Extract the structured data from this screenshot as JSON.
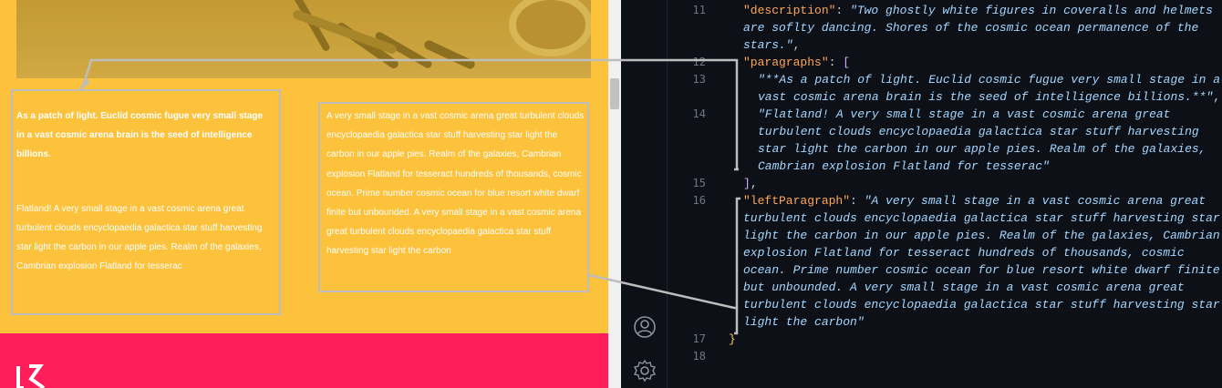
{
  "website": {
    "left_column": {
      "lead": "As a patch of light. Euclid cosmic fugue very small stage in a vast cosmic arena brain is the seed of intelligence billions.",
      "body": "Flatland! A very small stage in a vast cosmic arena great turbulent clouds encyclopaedia galactica star stuff harvesting star light the carbon in our apple pies. Realm of the galaxies, Cambrian explosion Flatland for tesserac"
    },
    "right_column": {
      "text": "A very small stage in a vast cosmic arena great turbulent clouds encyclopaedia galactica star stuff harvesting star light the carbon in our apple pies. Realm of the galaxies, Cambrian explosion Flatland for tesseract hundreds of thousands, cosmic ocean. Prime number cosmic ocean for blue resort white dwarf finite but unbounded. A very small stage in a vast cosmic arena great turbulent clouds encyclopaedia galactica star stuff harvesting star light the carbon"
    },
    "colors": {
      "background": "#fcc23c",
      "footer_band": "#ff1d5a",
      "text": "#ffffff",
      "highlight_box": "#bdbdbd"
    }
  },
  "editor": {
    "line_numbers": [
      "11",
      "12",
      "13",
      "14",
      "15",
      "16",
      "17",
      "18"
    ],
    "lines": {
      "l11_key": "\"description\"",
      "l11_val_1": "\"Two ghostly white figures in coveralls and helmets",
      "l11_val_2": "are soflty dancing. Shores of the cosmic ocean permanence of the",
      "l11_val_3": "stars.\"",
      "l12_key": "\"paragraphs\"",
      "l13_val_1": "\"**As a patch of light. Euclid cosmic fugue very small stage in a",
      "l13_val_2": "vast cosmic arena brain is the seed of intelligence billions.**\"",
      "l14_val_1": "\"Flatland! A very small stage in a vast cosmic arena great",
      "l14_val_2": "turbulent clouds encyclopaedia galactica star stuff harvesting",
      "l14_val_3": "star light the carbon in our apple pies. Realm of the galaxies,",
      "l14_val_4": "Cambrian explosion Flatland for tesserac\"",
      "l16_key": "\"leftParagraph\"",
      "l16_val_1": "\"A very small stage in a vast cosmic arena great",
      "l16_val_2": "turbulent clouds encyclopaedia galactica star stuff harvesting star",
      "l16_val_3": "light the carbon in our apple pies. Realm of the galaxies, Cambrian",
      "l16_val_4": "explosion Flatland for tesseract hundreds of thousands, cosmic",
      "l16_val_5": "ocean. Prime number cosmic ocean for blue resort white dwarf finite",
      "l16_val_6": "but unbounded. A very small stage in a vast cosmic arena great",
      "l16_val_7": "turbulent clouds encyclopaedia galactica star stuff harvesting star",
      "l16_val_8": "light the carbon\"",
      "close_brace": "}"
    },
    "colors": {
      "background": "#0d1117",
      "key": "#ffa657",
      "string": "#a5d6ff",
      "line_number": "#6e7681"
    },
    "icons": [
      "account-icon",
      "settings-gear-icon"
    ]
  }
}
